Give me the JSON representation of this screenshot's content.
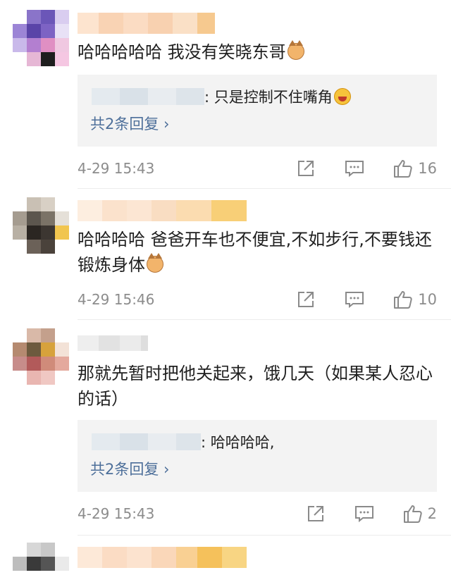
{
  "comments": [
    {
      "text": "哈哈哈哈哈 我没有笑晓东哥",
      "emoji": "cat-emoji",
      "reply": {
        "text": ": 只是控制不住嘴角",
        "emoji": "laughing-emoji",
        "more": "共2条回复 ›"
      },
      "time": "4-29 15:43",
      "likes": "16"
    },
    {
      "text": "哈哈哈哈 爸爸开车也不便宜,不如步行,不要钱还锻炼身体",
      "emoji": "cat-emoji",
      "time": "4-29 15:46",
      "likes": "10"
    },
    {
      "text": "那就先暂时把他关起来，饿几天（如果某人忍心的话）",
      "reply": {
        "text": ": 哈哈哈哈,",
        "more": "共2条回复 ›"
      },
      "time": "4-29 15:43",
      "likes": "2"
    }
  ],
  "icons": {
    "share": "share-icon",
    "comment": "comment-icon",
    "like": "thumbs-up-icon"
  },
  "colors": {
    "link": "#4d6f9a",
    "meta": "#8c8c8c",
    "reply_bg": "#f3f3f3"
  }
}
